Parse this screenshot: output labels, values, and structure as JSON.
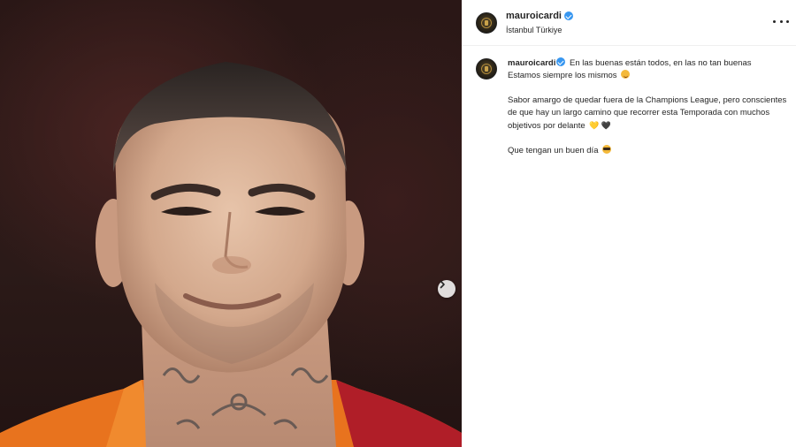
{
  "post": {
    "username": "mauroicardi",
    "location": "İstanbul Türkiye",
    "caption": {
      "line1": "En las buenas están todos, en las no tan buenas",
      "line2": "Estamos siempre los mismos",
      "para2": "Sabor amargo de quedar fuera de la Champions League, pero conscientes de que hay un largo camino que recorrer esta Temporada con muchos objetivos por delante",
      "para3": "Que tengan un buen día",
      "heart_yellow": "💛",
      "heart_black": "🖤"
    }
  },
  "icons": {
    "verified": "verified-badge-icon",
    "more": "more-options-icon",
    "next": "chevron-right-icon"
  },
  "colors": {
    "verified_blue": "#3897f0",
    "jersey_orange": "#e8731e",
    "jersey_red": "#b01e28"
  }
}
